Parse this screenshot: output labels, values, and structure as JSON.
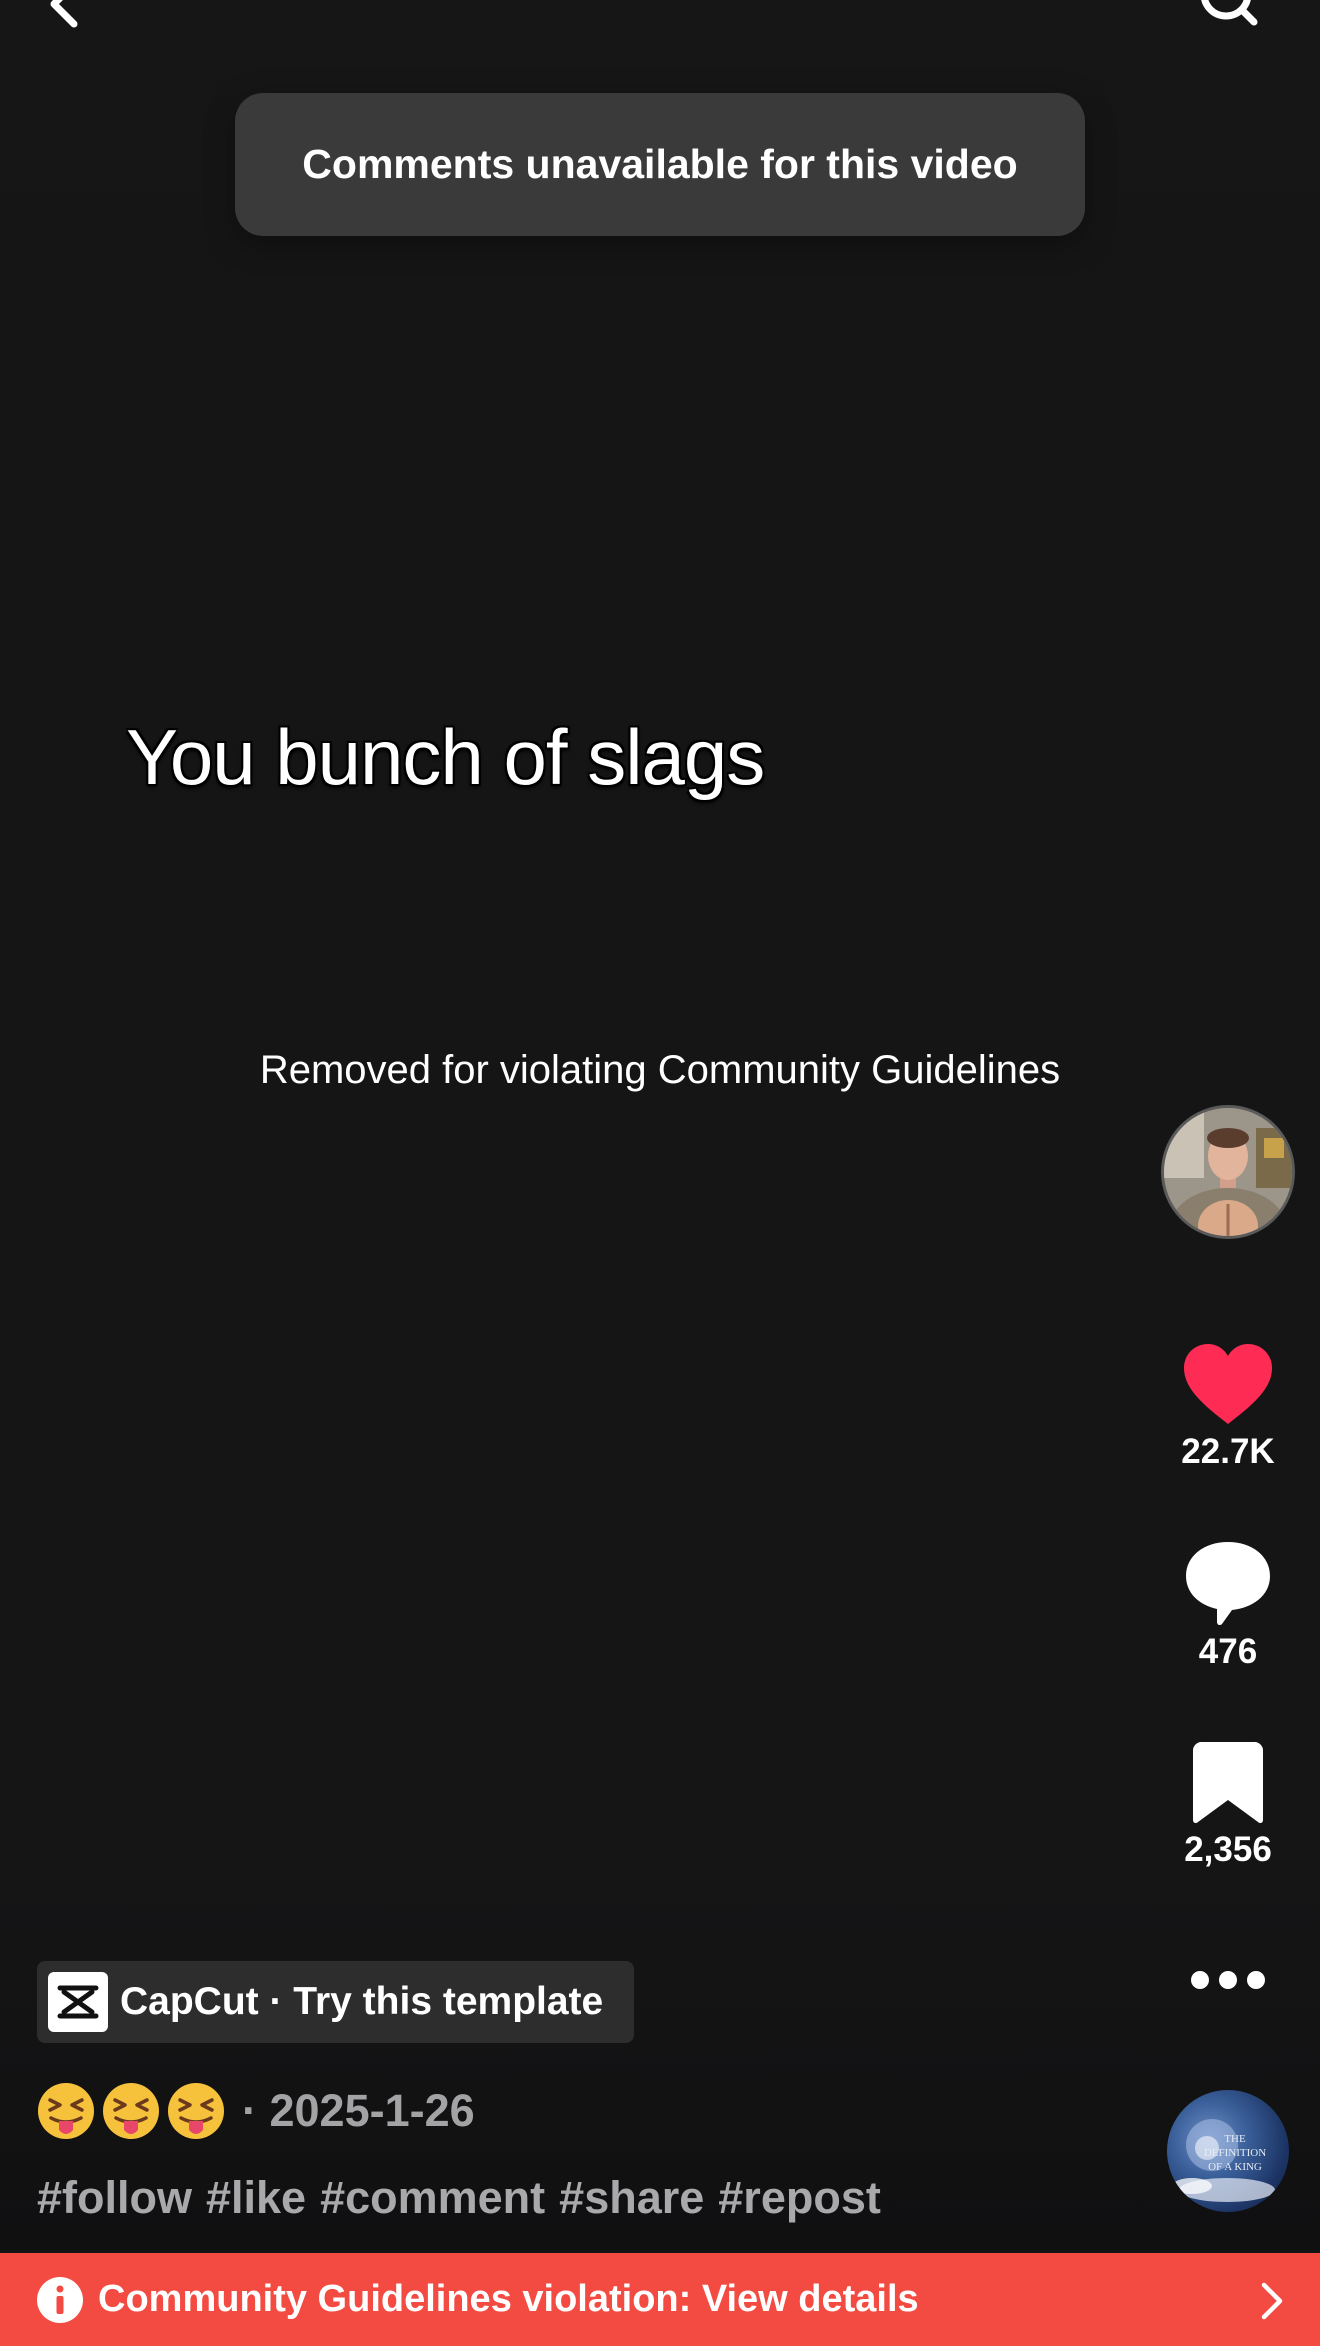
{
  "toast": {
    "message": "Comments unavailable for this video"
  },
  "video": {
    "overlay_caption": "You bunch of slags",
    "status_text": "Removed for violating Community Guidelines"
  },
  "actions": {
    "likes": "22.7K",
    "comments": "476",
    "saves": "2,356"
  },
  "capcut": {
    "label": "CapCut · Try this template"
  },
  "description": {
    "emojis": [
      "😝",
      "😝",
      "😝"
    ],
    "date": "· 2025-1-26",
    "hashtags": [
      "#follow",
      "#like",
      "#comment",
      "#share",
      "#repost"
    ]
  },
  "sound": {
    "disc_text": "THE DEFINITION OF A KING"
  },
  "violation_banner": {
    "text": "Community Guidelines violation: View details"
  },
  "colors": {
    "background": "#151516",
    "like_red": "#fe2c55",
    "banner_red": "#f34a41",
    "toast_bg": "#3a3a3b",
    "muted_text": "#a9a9ab"
  },
  "icons": [
    "back-chevron-icon",
    "search-icon",
    "heart-icon",
    "comment-bubble-icon",
    "bookmark-icon",
    "more-dots-icon",
    "capcut-logo-icon",
    "info-icon",
    "chevron-right-icon"
  ]
}
